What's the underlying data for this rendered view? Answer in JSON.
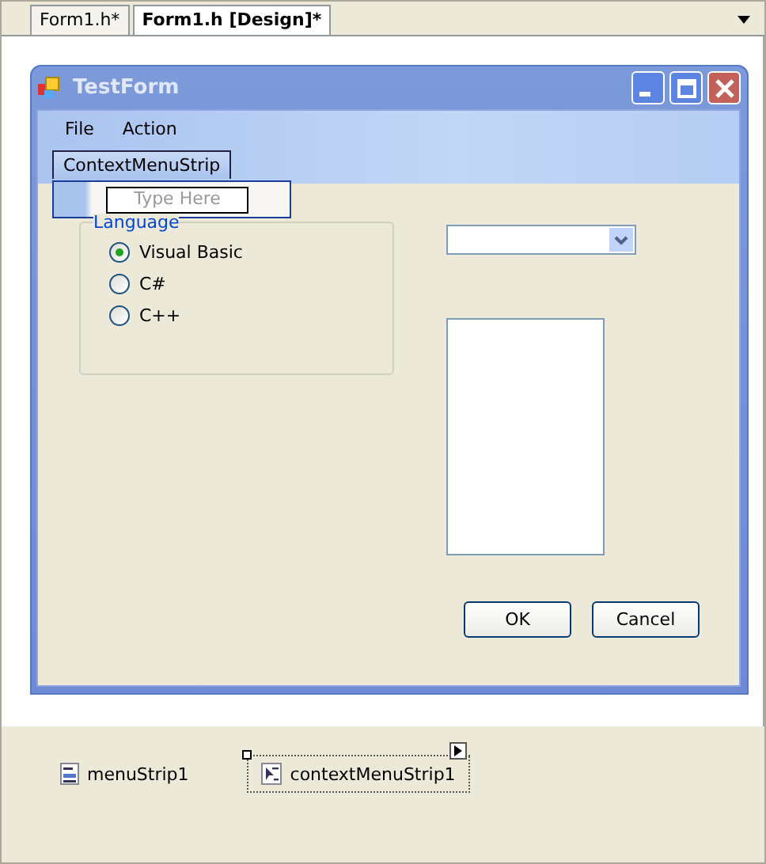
{
  "tabs": [
    {
      "label": "Form1.h*",
      "selected": false
    },
    {
      "label": "Form1.h [Design]*",
      "selected": true
    }
  ],
  "form": {
    "title": "TestForm",
    "menu": [
      "File",
      "Action"
    ],
    "context_menu": {
      "label": "ContextMenuStrip",
      "placeholder": "Type Here"
    },
    "group": {
      "label": "Language",
      "options": [
        {
          "label": "Visual Basic",
          "selected": true
        },
        {
          "label": "C#",
          "selected": false
        },
        {
          "label": "C++",
          "selected": false
        }
      ]
    },
    "buttons": [
      "OK",
      "Cancel"
    ]
  },
  "tray": [
    {
      "label": "menuStrip1",
      "kind": "menu",
      "selected": false
    },
    {
      "label": "contextMenuStrip1",
      "kind": "context",
      "selected": true
    }
  ]
}
